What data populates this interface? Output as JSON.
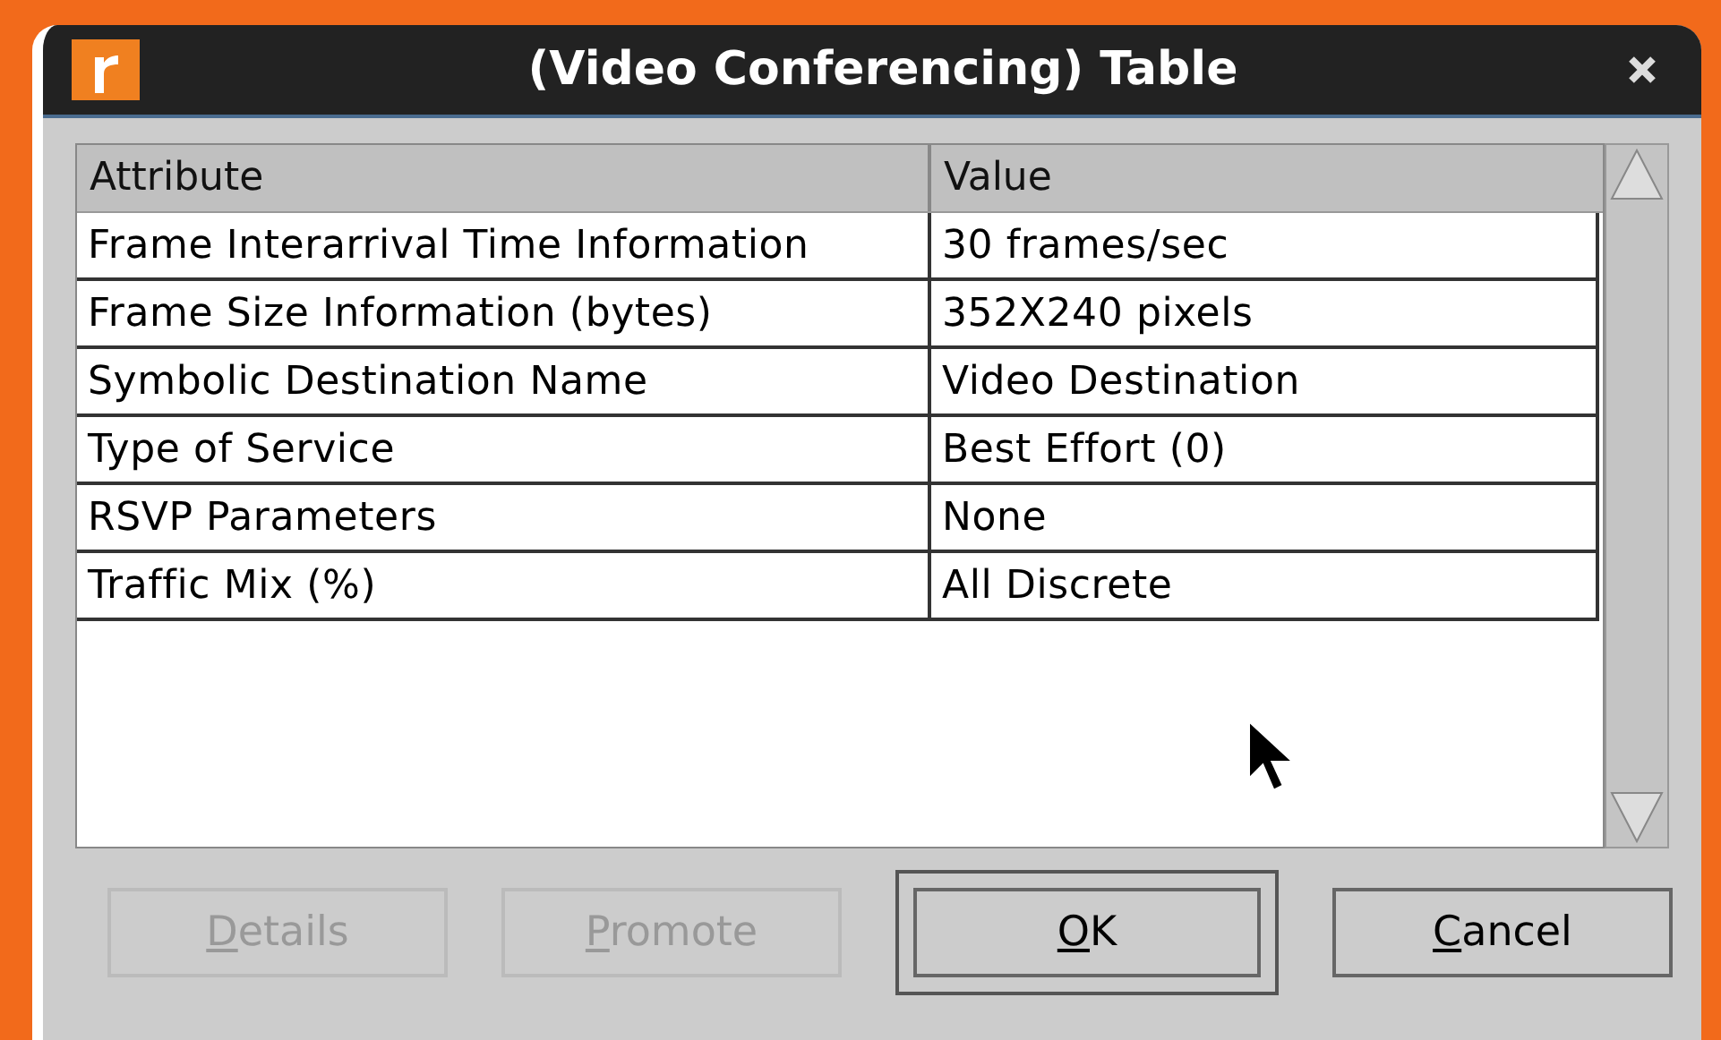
{
  "window": {
    "title": "(Video Conferencing) Table"
  },
  "table": {
    "columns": [
      "Attribute",
      "Value"
    ],
    "rows": [
      {
        "attribute": "Frame Interarrival Time Information",
        "value": "30 frames/sec"
      },
      {
        "attribute": "Frame Size Information (bytes)",
        "value": "352X240 pixels"
      },
      {
        "attribute": "Symbolic Destination Name",
        "value": "Video Destination"
      },
      {
        "attribute": "Type of Service",
        "value": "Best Effort (0)"
      },
      {
        "attribute": "RSVP Parameters",
        "value": "None"
      },
      {
        "attribute": "Traffic Mix (%)",
        "value": "All Discrete"
      }
    ]
  },
  "buttons": [
    {
      "label": "Details",
      "disabled": true,
      "default": false,
      "underline_first": true
    },
    {
      "label": "Promote",
      "disabled": true,
      "default": false,
      "underline_first": true
    },
    {
      "label": "OK",
      "disabled": false,
      "default": true,
      "underline_first": true
    },
    {
      "label": "Cancel",
      "disabled": false,
      "default": false,
      "underline_first": true
    }
  ]
}
